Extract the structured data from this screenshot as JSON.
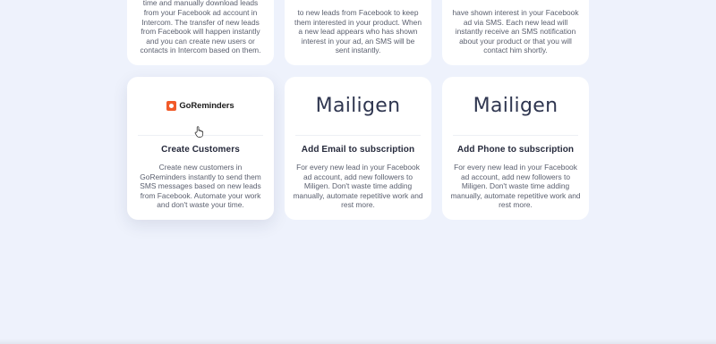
{
  "top_cards": [
    {
      "description": "time and manually download leads from your Facebook ad account in Intercom. The transfer of new leads from Facebook will happen instantly and you can create new users or contacts in Intercom based on them."
    },
    {
      "description": "to new leads from Facebook to keep them interested in your product. When a new lead appears who has shown interest in your ad, an SMS will be sent instantly."
    },
    {
      "description": "have shown interest in your Facebook ad via SMS. Each new lead will instantly receive an SMS notification about your product or that you will contact him shortly."
    }
  ],
  "cards": [
    {
      "logo_text": "GoReminders",
      "logo_icon": "goreminders-logo-icon",
      "title": "Create Customers",
      "description": "Create new customers in GoReminders instantly to send them SMS messages based on new leads from Facebook. Automate your work and don't waste your time."
    },
    {
      "logo_text": "Mailigen",
      "title": "Add Email to subscription",
      "description": "For every new lead in your Facebook ad account, add new followers to Miligen. Don't waste time adding manually, automate repetitive work and rest more."
    },
    {
      "logo_text": "Mailigen",
      "title": "Add Phone to subscription",
      "description": "For every new lead in your Facebook ad account, add new followers to Miligen. Don't waste time adding manually, automate repetitive work and rest more."
    }
  ],
  "colors": {
    "page_background": "#eef2fc",
    "card_background": "#ffffff",
    "title_text": "#262a3c",
    "body_text": "#5a5f6e",
    "goreminders_brand": "#f15a29",
    "mailigen_brand": "#2f3650"
  },
  "cursor_icon": "hand-pointer-icon"
}
